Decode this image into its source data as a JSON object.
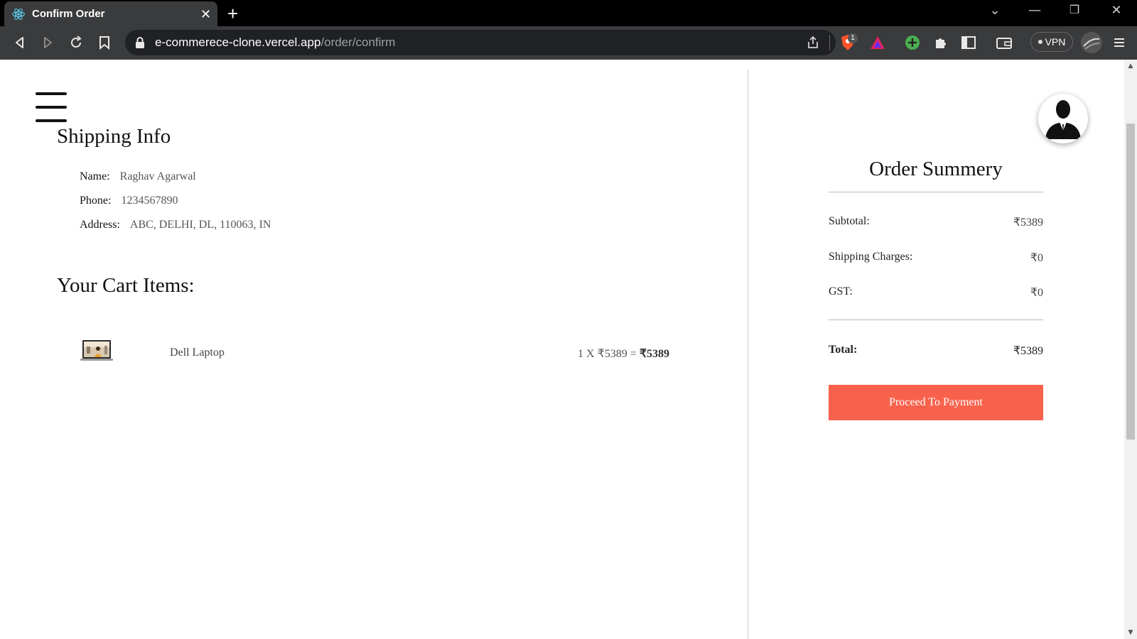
{
  "browser": {
    "tab_title": "Confirm Order",
    "tab_close": "✕",
    "new_tab": "+",
    "url_host": "e-commerece-clone.vercel.app",
    "url_path": "/order/confirm",
    "vpn_label": "VPN",
    "brave_badge": "1"
  },
  "page": {
    "shipping_title": "Shipping Info",
    "shipping": {
      "name_label": "Name:",
      "name_value": "Raghav Agarwal",
      "phone_label": "Phone:",
      "phone_value": "1234567890",
      "address_label": "Address:",
      "address_value": "ABC, DELHI, DL, 110063, IN"
    },
    "cart_title": "Your Cart Items:",
    "cart_items": [
      {
        "name": "Dell Laptop",
        "qty_price": "1 X ₹5389 = ",
        "total": "₹5389"
      }
    ],
    "summary": {
      "title": "Order Summery",
      "subtotal_label": "Subtotal:",
      "subtotal_value": "₹5389",
      "shipping_label": "Shipping Charges:",
      "shipping_value": "₹0",
      "gst_label": "GST:",
      "gst_value": "₹0",
      "total_label": "Total:",
      "total_value": "₹5389",
      "pay_button": "Proceed To Payment"
    }
  },
  "colors": {
    "accent": "#f8624c",
    "chrome_dark": "#000000",
    "chrome_toolbar": "#3a3b3d"
  }
}
